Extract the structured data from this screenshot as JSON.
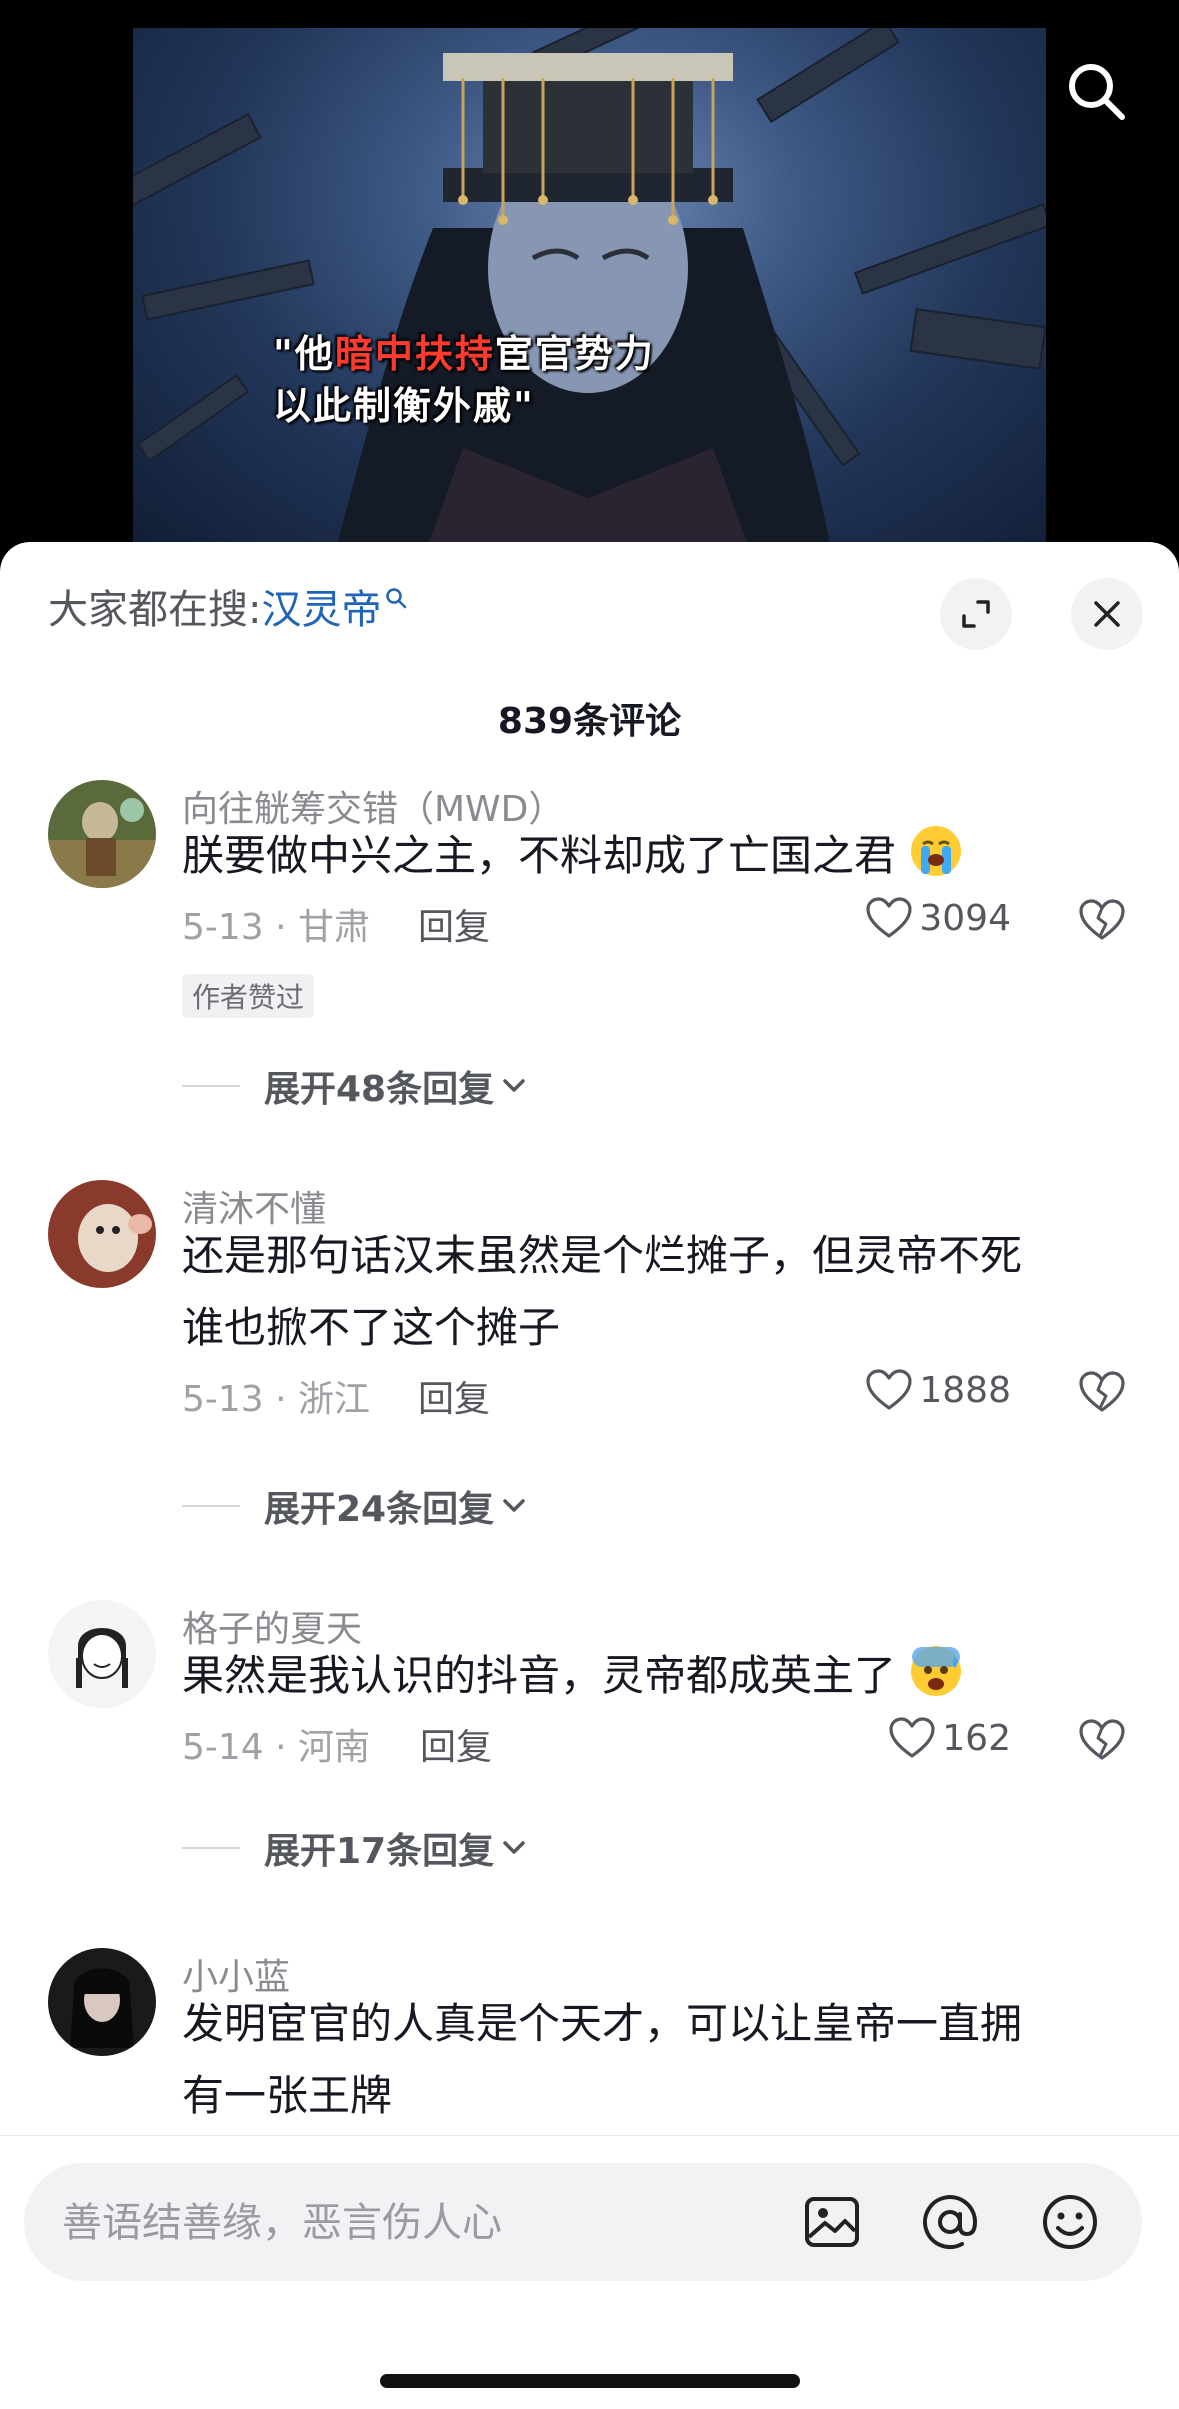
{
  "video": {
    "caption_line1_quote_open": "\"他",
    "caption_line1_highlight": "暗中扶持",
    "caption_line1_rest": "宦官势力",
    "caption_line2": "以此制衡外戚\"",
    "search_icon": "search-icon"
  },
  "sheet": {
    "hot_search_prefix": "大家都在搜:",
    "hot_search_term": "汉灵帝",
    "comment_count": "839条评论"
  },
  "comments": [
    {
      "user": "向往觥筹交错（MWD）",
      "text": "朕要做中兴之主，不料却成了亡国之君",
      "emoji": "loudly-crying-face",
      "date_location": "5-13 · 甘肃",
      "reply_label": "回复",
      "likes": "3094",
      "badge": "作者赞过",
      "expand_label": "展开48条回复"
    },
    {
      "user": "清沐不懂",
      "text_line1": "还是那句话汉末虽然是个烂摊子，但灵帝不死",
      "text_line2": "谁也掀不了这个摊子",
      "date_location": "5-13 · 浙江",
      "reply_label": "回复",
      "likes": "1888",
      "expand_label": "展开24条回复"
    },
    {
      "user": "格子的夏天",
      "text": "果然是我认识的抖音，灵帝都成英主了",
      "emoji": "anxious-face-with-sweat",
      "date_location": "5-14 · 河南",
      "reply_label": "回复",
      "likes": "162",
      "expand_label": "展开17条回复"
    },
    {
      "user": "小小蓝",
      "text_line1": "发明宦官的人真是个天才，可以让皇帝一直拥",
      "text_line2": "有一张王牌"
    }
  ],
  "input": {
    "placeholder": "善语结善缘，恶言伤人心"
  },
  "colors": {
    "link_blue": "#1f64b8",
    "caption_red": "#ff3b30",
    "text_primary": "#161823",
    "text_secondary": "#8a8b91"
  }
}
